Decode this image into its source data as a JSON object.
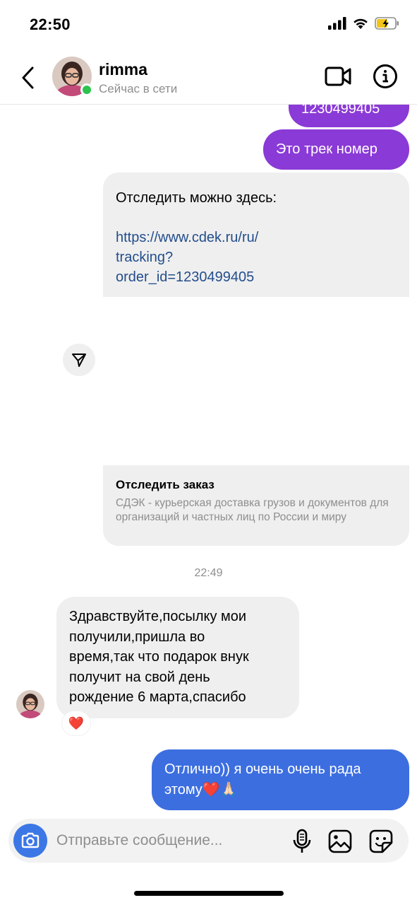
{
  "status_bar": {
    "time": "22:50"
  },
  "header": {
    "contact_name": "rimma",
    "contact_status": "Сейчас в сети"
  },
  "messages": {
    "clipped_number": "1230499405",
    "track_label": "Это трек номер",
    "tracking_intro": "Отследить можно здесь:",
    "tracking_url_lines": [
      "https://www.cdek.ru/ru/",
      "tracking?",
      "order_id=1230499405"
    ],
    "link_preview": {
      "title": "Отследить заказ",
      "description": "СДЭК - курьерская доставка грузов и документов для организаций и частных лиц по России и миру"
    },
    "timestamp": "22:49",
    "incoming_lines": [
      "Здравствуйте,посылку мои",
      "получили,пришла во",
      "время,так что подарок внук",
      "получит на свой день",
      "рождение 6 марта,спасибо"
    ],
    "reaction": "❤️",
    "outgoing_lines": [
      "Отлично)) я очень очень рада",
      "этому❤️🙏🏻"
    ]
  },
  "composer": {
    "placeholder": "Отправьте сообщение..."
  },
  "colors": {
    "purple_bubble": "#8a3ad6",
    "blue_bubble": "#3c6ee0",
    "gray_bubble": "#efefef",
    "online": "#2bc44e",
    "camera_button": "#3c77e6",
    "link": "#234e8c"
  },
  "icons": {
    "back": "chevron-left-icon",
    "video": "video-camera-icon",
    "info": "info-icon",
    "share": "send-arrow-icon",
    "camera": "camera-icon",
    "mic": "microphone-icon",
    "gallery": "image-icon",
    "sticker": "sticker-icon"
  }
}
